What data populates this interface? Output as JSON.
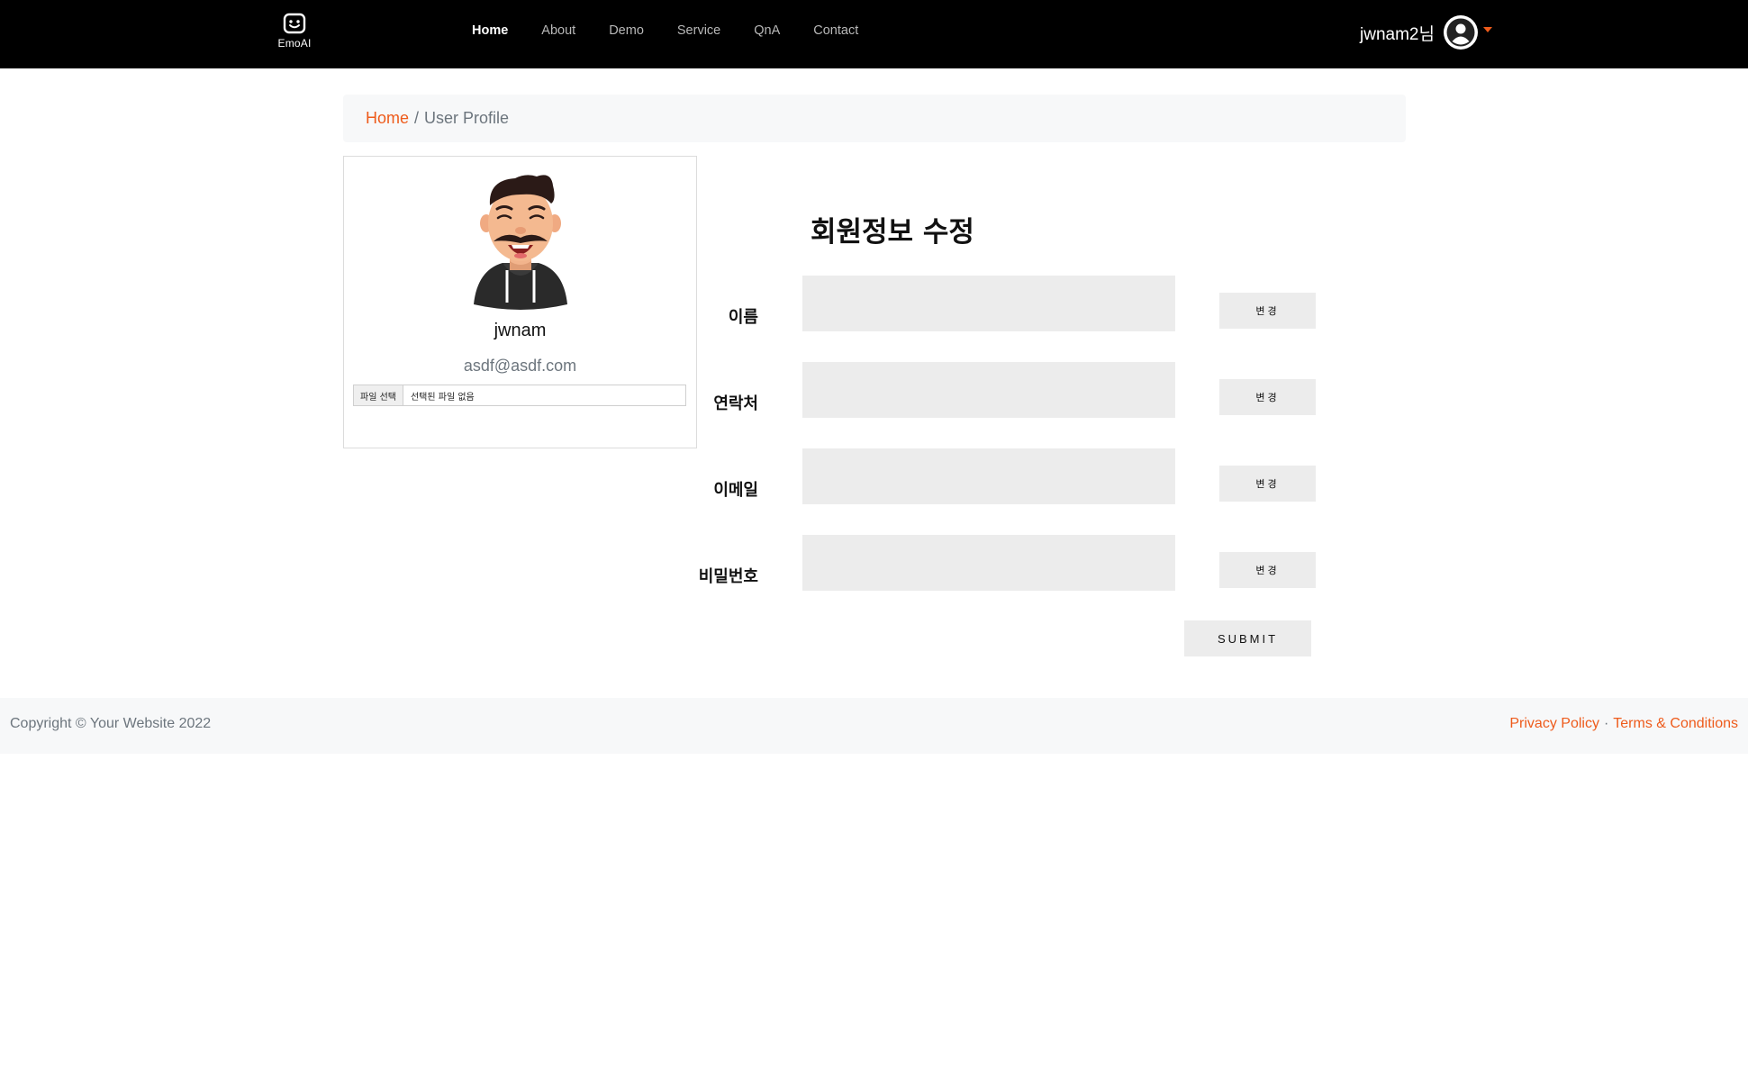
{
  "header": {
    "brand": "EmoAI",
    "brand_icon": "smiley-robot-icon",
    "nav": [
      {
        "label": "Home",
        "active": true
      },
      {
        "label": "About",
        "active": false
      },
      {
        "label": "Demo",
        "active": false
      },
      {
        "label": "Service",
        "active": false
      },
      {
        "label": "QnA",
        "active": false
      },
      {
        "label": "Contact",
        "active": false
      }
    ],
    "user_name": "jwnam2님",
    "user_icon": "user-avatar-icon",
    "accent": "#ee5b1b"
  },
  "breadcrumb": {
    "home": "Home",
    "separator": "/",
    "current": "User Profile"
  },
  "profile": {
    "avatar_icon": "cartoon-man-avatar",
    "name": "jwnam",
    "email": "asdf@asdf.com",
    "file_button": "파일 선택",
    "file_status": "선택된 파일 없음"
  },
  "form": {
    "title": "회원정보 수정",
    "rows": [
      {
        "label": "이름",
        "value": "",
        "button": "변경"
      },
      {
        "label": "연락처",
        "value": "",
        "button": "변경"
      },
      {
        "label": "이메일",
        "value": "",
        "button": "변경"
      },
      {
        "label": "비밀번호",
        "value": "",
        "button": "변경"
      }
    ],
    "submit": "SUBMIT"
  },
  "footer": {
    "copyright": "Copyright © Your Website 2022",
    "privacy": "Privacy Policy",
    "dot": "·",
    "terms": "Terms & Conditions"
  }
}
